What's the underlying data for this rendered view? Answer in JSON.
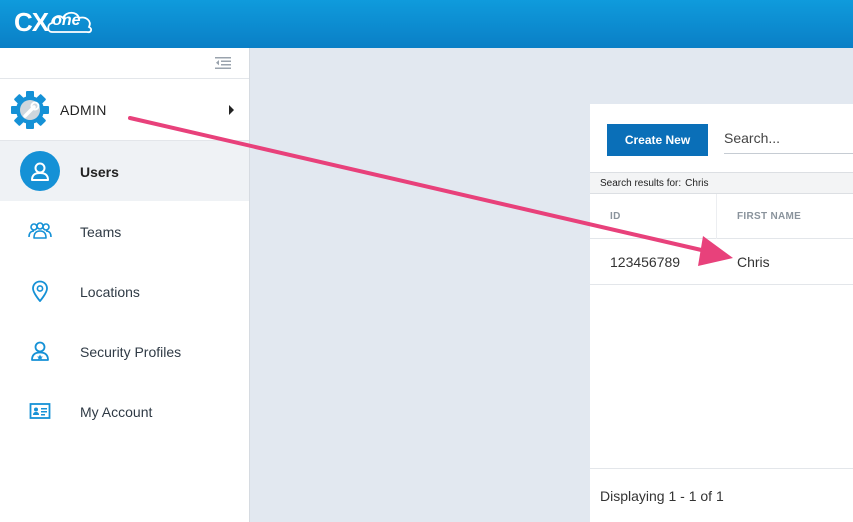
{
  "brand": {
    "logo_main": "CX",
    "logo_sub": "one",
    "color": "#0a7fc6"
  },
  "sidebar": {
    "collapse_icon": "collapse-menu-icon",
    "admin": {
      "label": "ADMIN",
      "icon": "gear-icon"
    },
    "items": [
      {
        "label": "Users",
        "icon": "user-icon",
        "active": true
      },
      {
        "label": "Teams",
        "icon": "teams-icon",
        "active": false
      },
      {
        "label": "Locations",
        "icon": "location-pin-icon",
        "active": false
      },
      {
        "label": "Security Profiles",
        "icon": "security-profile-icon",
        "active": false
      },
      {
        "label": "My Account",
        "icon": "id-card-icon",
        "active": false
      }
    ]
  },
  "panel": {
    "create_label": "Create New",
    "search_placeholder": "Search...",
    "results_label": "Search results for:",
    "results_term": "Chris",
    "columns": [
      "ID",
      "FIRST NAME"
    ],
    "rows": [
      {
        "id": "123456789",
        "first_name": "Chris"
      }
    ],
    "footer": "Displaying 1 - 1 of 1"
  },
  "annotation": {
    "color": "#e8417b"
  }
}
